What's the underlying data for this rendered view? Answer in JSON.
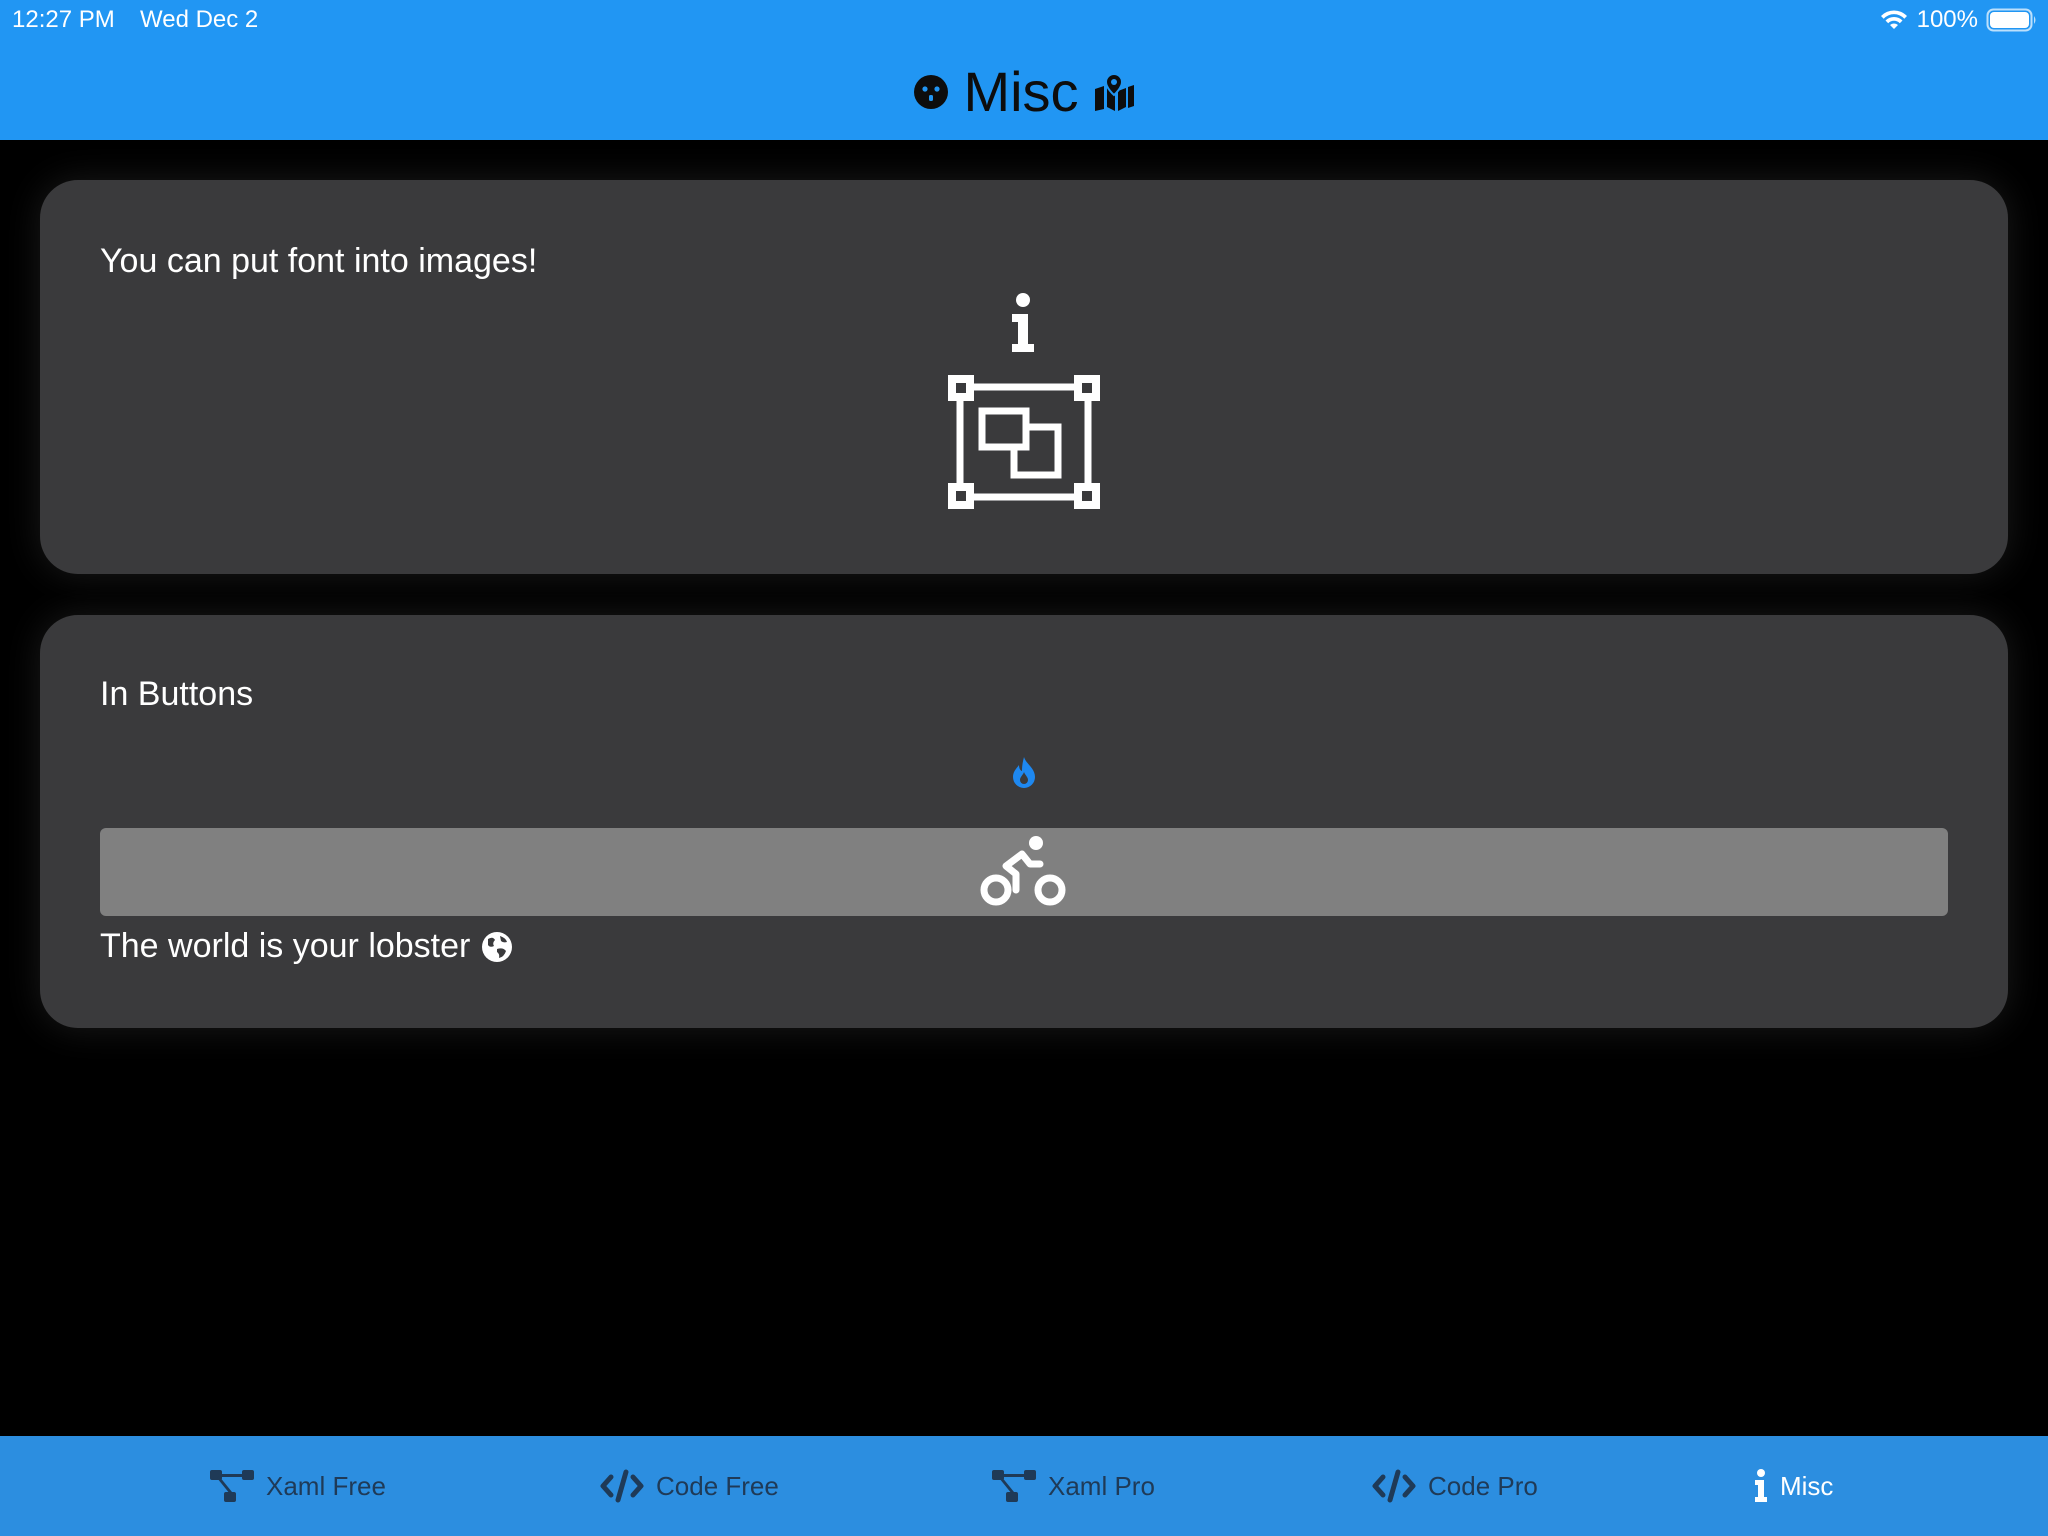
{
  "status_bar": {
    "time": "12:27 PM",
    "date": "Wed Dec 2",
    "battery": "100%"
  },
  "nav": {
    "title": "Misc",
    "left_icon": "outlet-icon",
    "right_icon": "map-marked-icon"
  },
  "cards": {
    "images": {
      "title": "You can put font into images!",
      "icons": [
        "info-icon",
        "object-ungroup-icon"
      ]
    },
    "buttons": {
      "title": "In Buttons",
      "fire_button_icon": "fire-icon",
      "bike_button_icon": "biking-icon",
      "lobster_text": "The world is your lobster",
      "lobster_icon": "globe-icon"
    }
  },
  "tabs": [
    {
      "label": "Xaml Free",
      "icon": "sitemap-icon"
    },
    {
      "label": "Code Free",
      "icon": "code-icon"
    },
    {
      "label": "Xaml Pro",
      "icon": "sitemap-icon"
    },
    {
      "label": "Code Pro",
      "icon": "code-icon"
    },
    {
      "label": "Misc",
      "icon": "info-icon",
      "active": true
    }
  ],
  "colors": {
    "nav_bar": "#2196F3",
    "tab_bar": "#2C8EE0",
    "card": "#3a3a3c",
    "button_gray": "#808080",
    "fire_blue": "#1E88F0",
    "tab_inactive": "#1f3a57"
  }
}
